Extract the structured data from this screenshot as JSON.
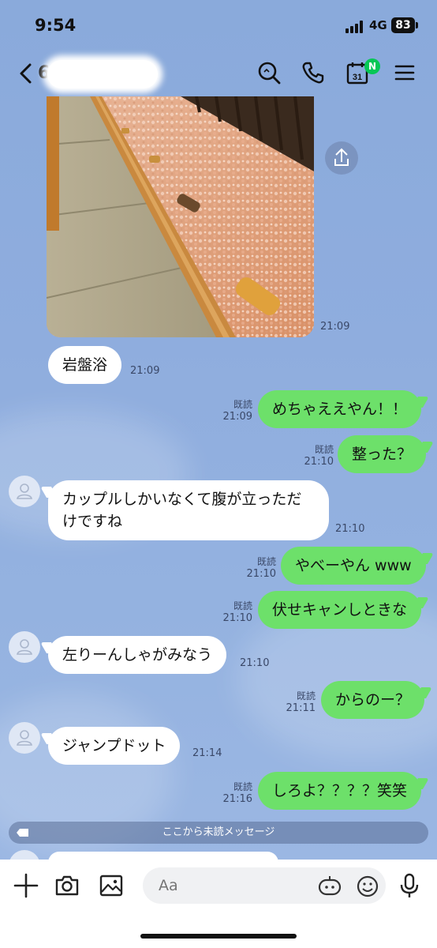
{
  "status_bar": {
    "time": "9:54",
    "network": "4G",
    "battery": "83"
  },
  "header": {
    "contact_name": "6",
    "calendar_day": "31",
    "badge": "N"
  },
  "photo": {
    "timestamp": "21:09"
  },
  "messages": [
    {
      "side": "in",
      "text": "岩盤浴",
      "time": "21:09"
    },
    {
      "side": "out",
      "text": "めちゃええやん！！",
      "time": "21:09",
      "read": "既読"
    },
    {
      "side": "out",
      "text": "整った？",
      "time": "21:10",
      "read": "既読"
    },
    {
      "side": "in",
      "text_line1": "カップルしかいなくて腹が立っただ",
      "text_line2": "けですね",
      "time": "21:10"
    },
    {
      "side": "out",
      "text": "やべーやん www",
      "time": "21:10",
      "read": "既読"
    },
    {
      "side": "out",
      "text": "伏せキャンしときな",
      "time": "21:10",
      "read": "既読"
    },
    {
      "side": "in",
      "text": "左りーんしゃがみなう",
      "time": "21:10"
    },
    {
      "side": "out",
      "text": "からのー？",
      "time": "21:11",
      "read": "既読"
    },
    {
      "side": "in",
      "text": "ジャンプドット",
      "time": "21:14"
    },
    {
      "side": "out",
      "text": "しろよ？？？？笑笑",
      "time": "21:16",
      "read": "既読"
    }
  ],
  "unread_divider": "ここから未読メッセージ",
  "input_bar": {
    "placeholder": "Aa"
  },
  "colors": {
    "accent_green": "#06c755",
    "outgoing_bubble": "#6de06a",
    "chat_background": "#8aaadb"
  }
}
